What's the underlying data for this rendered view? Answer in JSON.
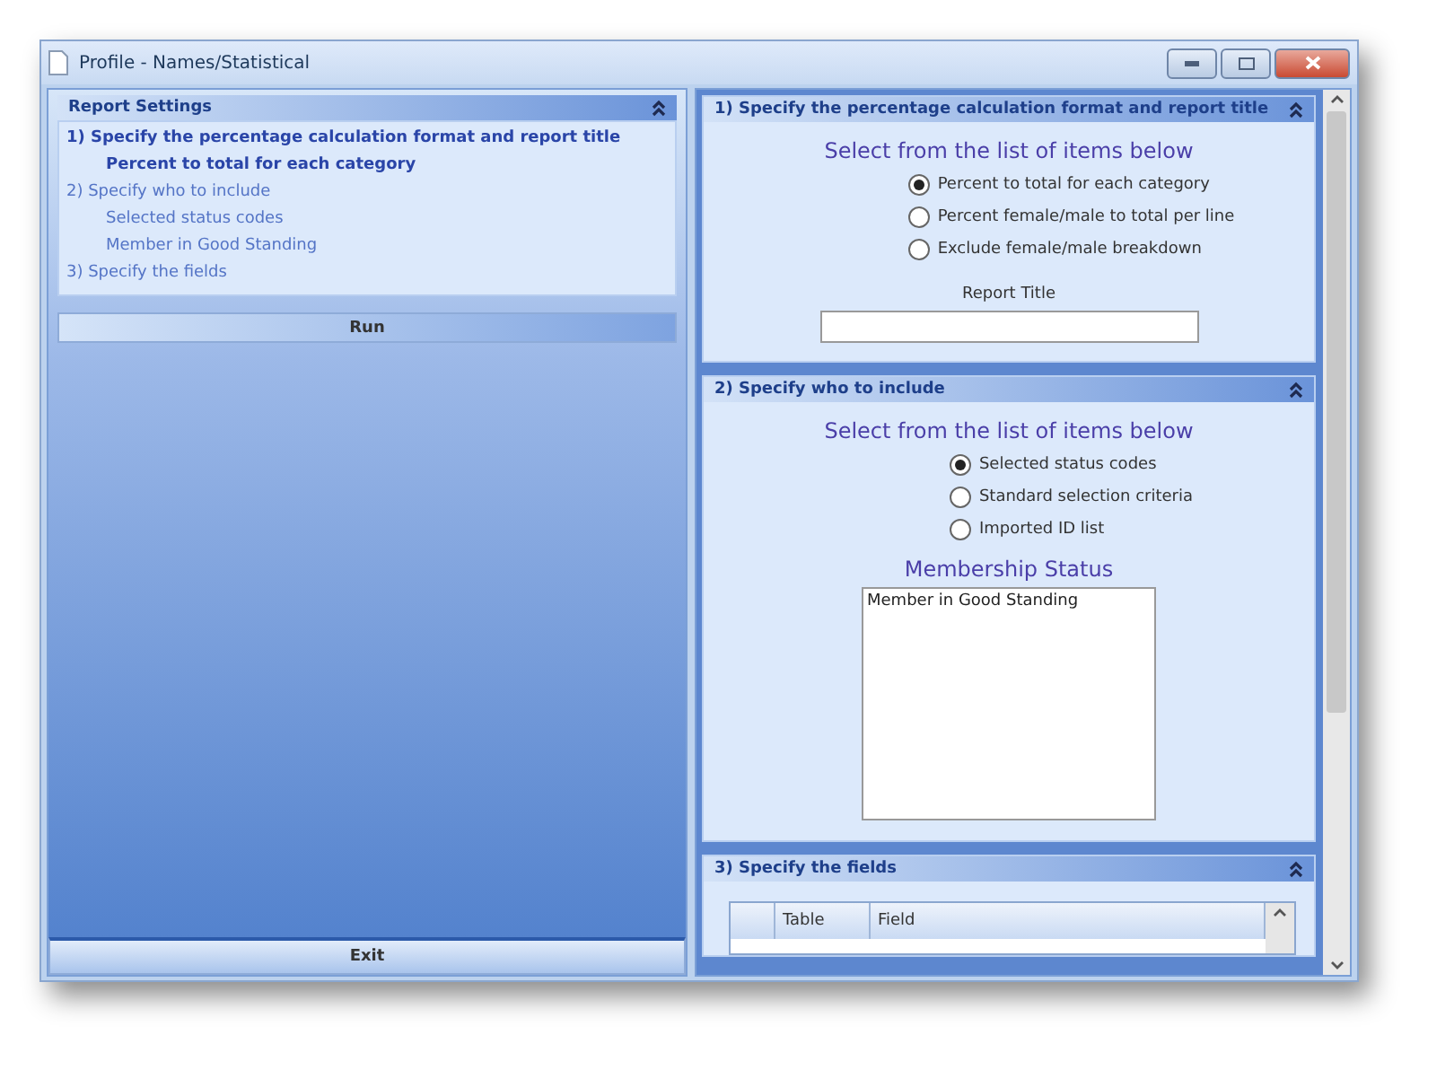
{
  "window": {
    "title": "Profile - Names/Statistical"
  },
  "report_settings": {
    "title": "Report Settings",
    "expanded": true,
    "items": [
      {
        "label": "1)  Specify the percentage calculation format and report title",
        "selected": true,
        "children": [
          {
            "label": "Percent to total for each category",
            "selected": true
          }
        ]
      },
      {
        "label": "2)  Specify who to include",
        "selected": false,
        "children": [
          {
            "label": "Selected status codes",
            "selected": false
          },
          {
            "label": "Member in Good Standing",
            "selected": false
          }
        ]
      },
      {
        "label": "3)  Specify the fields",
        "selected": false
      }
    ]
  },
  "run_button": "Run",
  "exit_button": "Exit",
  "sections": [
    {
      "kind": "format",
      "title": "1)  Specify the percentage calculation format and report title",
      "expanded": true,
      "prompt": "Select from the list of items below",
      "options": [
        {
          "label": "Percent to total for each category",
          "selected": true
        },
        {
          "label": "Percent female/male to total per line",
          "selected": false
        },
        {
          "label": "Exclude female/male breakdown",
          "selected": false
        }
      ],
      "field_label": "Report Title"
    },
    {
      "kind": "include",
      "title": "2)  Specify who to include",
      "expanded": true,
      "prompt": "Select from the list of items below",
      "options": [
        {
          "label": "Selected status codes",
          "selected": true
        },
        {
          "label": "Standard selection criteria",
          "selected": false
        },
        {
          "label": "Imported ID list",
          "selected": false
        }
      ],
      "list_label": "Membership Status",
      "list_items": [
        "Member in Good Standing"
      ]
    },
    {
      "kind": "fields",
      "title": "3)  Specify the fields",
      "expanded": true,
      "columns": [
        "Table",
        "Field"
      ]
    }
  ]
}
